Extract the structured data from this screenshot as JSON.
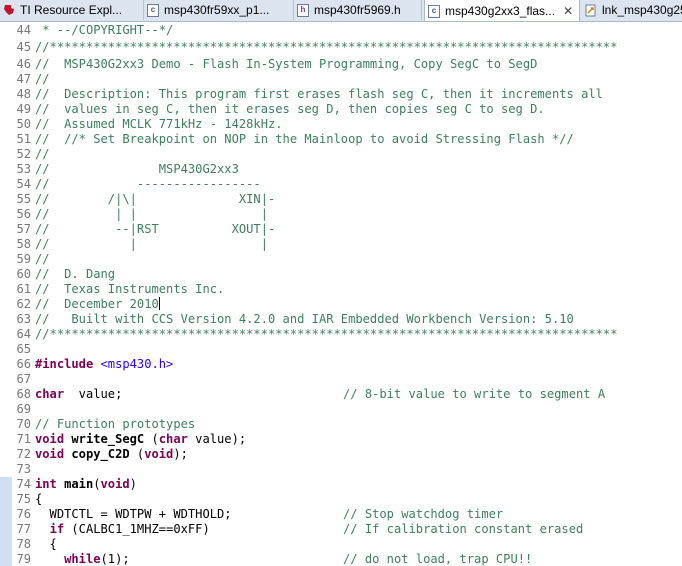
{
  "tabs": [
    {
      "label": "TI Resource Expl...",
      "icon": "ti-logo-icon",
      "active": false
    },
    {
      "label": "msp430fr59xx_p1...",
      "icon": "c-file-icon",
      "active": false
    },
    {
      "label": "msp430fr5969.h",
      "icon": "h-file-icon",
      "active": false
    },
    {
      "label": "msp430g2xx3_flas...",
      "icon": "c-file-icon",
      "active": true,
      "close": "✕"
    },
    {
      "label": "lnk_msp430g25",
      "icon": "linker-file-icon",
      "active": false
    }
  ],
  "first_visible_line": 45,
  "code": {
    "l44": " * --/COPYRIGHT--*/",
    "l45": "//******************************************************************************",
    "l46": "//  MSP430G2xx3 Demo - Flash In-System Programming, Copy SegC to SegD",
    "l47": "//",
    "l48": "//  Description: This program first erases flash seg C, then it increments all",
    "l49": "//  values in seg C, then it erases seg D, then copies seg C to seg D.",
    "l50": "//  Assumed MCLK 771kHz - 1428kHz.",
    "l51": "//  //* Set Breakpoint on NOP in the Mainloop to avoid Stressing Flash *//",
    "l52": "//",
    "l53": "//               MSP430G2xx3",
    "l54": "//            -----------------",
    "l55": "//        /|\\|              XIN|-",
    "l56": "//         | |                 |",
    "l57": "//         --|RST          XOUT|-",
    "l58": "//           |                 |",
    "l59": "//",
    "l60": "//  D. Dang",
    "l61": "//  Texas Instruments Inc.",
    "l62": "//  December 2010",
    "l63": "//   Built with CCS Version 4.2.0 and IAR Embedded Workbench Version: 5.10",
    "l64": "//******************************************************************************",
    "l65": "",
    "l66_kw": "#include",
    "l66_file": " <msp430.h>",
    "l67": "",
    "l68_kw": "char",
    "l68_code": "  value;",
    "l68_comment": "// 8-bit value to write to segment A",
    "l69": "",
    "l70": "// Function prototypes",
    "l71_kw": "void",
    "l71_fn": "write_SegC",
    "l71_pre": " (",
    "l71_kw2": "char",
    "l71_rest": " value);",
    "l72_kw": "void",
    "l72_fn": "copy_C2D",
    "l72_pre": " (",
    "l72_kw2": "void",
    "l72_rest": ");",
    "l73": "",
    "l74_kw": "int",
    "l74_fn": "main",
    "l74_pre": "(",
    "l74_kw2": "void",
    "l74_rest": ")",
    "l75": "{",
    "l76_code": "  WDTCTL = WDTPW + WDTHOLD;",
    "l76_comment": "// Stop watchdog timer",
    "l77_kw": "if",
    "l77_code": " (CALBC1_1MHZ==0xFF)",
    "l77_comment": "// If calibration constant erased",
    "l78": "  {",
    "l79_kw": "while",
    "l79_code": "(1);",
    "l79_comment": "// do not load, trap CPU!!"
  }
}
